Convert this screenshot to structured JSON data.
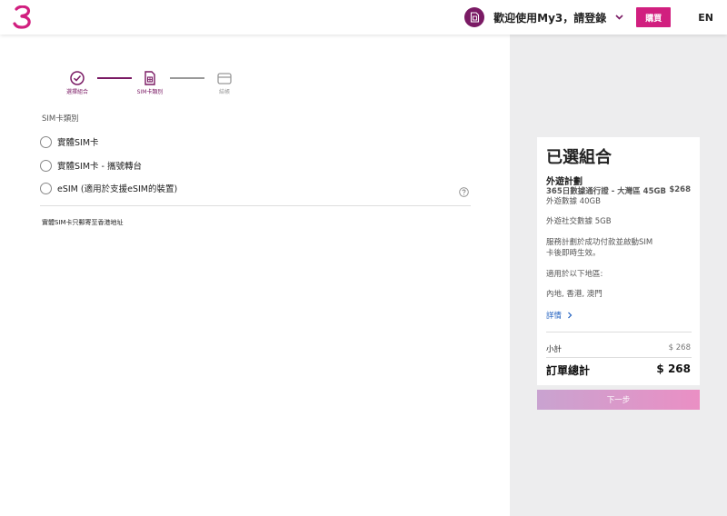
{
  "header": {
    "welcome": "歡迎使用My3，請登錄",
    "buy_label": "購買",
    "lang_label": "EN"
  },
  "stepper": {
    "steps": [
      {
        "label": "選擇組合",
        "state": "done"
      },
      {
        "label": "SIM卡類別",
        "state": "active"
      },
      {
        "label": "結帳",
        "state": "pending"
      }
    ]
  },
  "sim_type": {
    "label": "SIM卡類別",
    "options": [
      {
        "label": "實體SIM卡"
      },
      {
        "label": "實體SIM卡 - 攜號轉台"
      },
      {
        "label": "eSIM (適用於支援eSIM的裝置)"
      }
    ],
    "note": "實體SIM卡只郵寄至香港地址"
  },
  "summary": {
    "title": "已選組合",
    "plan_name": "外遊計劃",
    "plan_sub": "365日數據通行證 - 大灣區 45GB",
    "plan_price": "$268",
    "lines": [
      "外遊數據 40GB",
      "外遊社交數據 5GB",
      "服務計劃於成功付款並啟動SIM",
      "卡後即時生效。",
      "適用於以下地區:",
      "內地, 香港, 澳門"
    ],
    "detail_link": "詳情",
    "subtotal_label": "小計",
    "subtotal_value": "$ 268",
    "total_label": "訂單總計",
    "total_value": "$ 268"
  },
  "next_button": "下一步",
  "colors": {
    "brand": "#d11f7f",
    "brand_dark": "#7a1a64",
    "link": "#1f5fbf"
  }
}
